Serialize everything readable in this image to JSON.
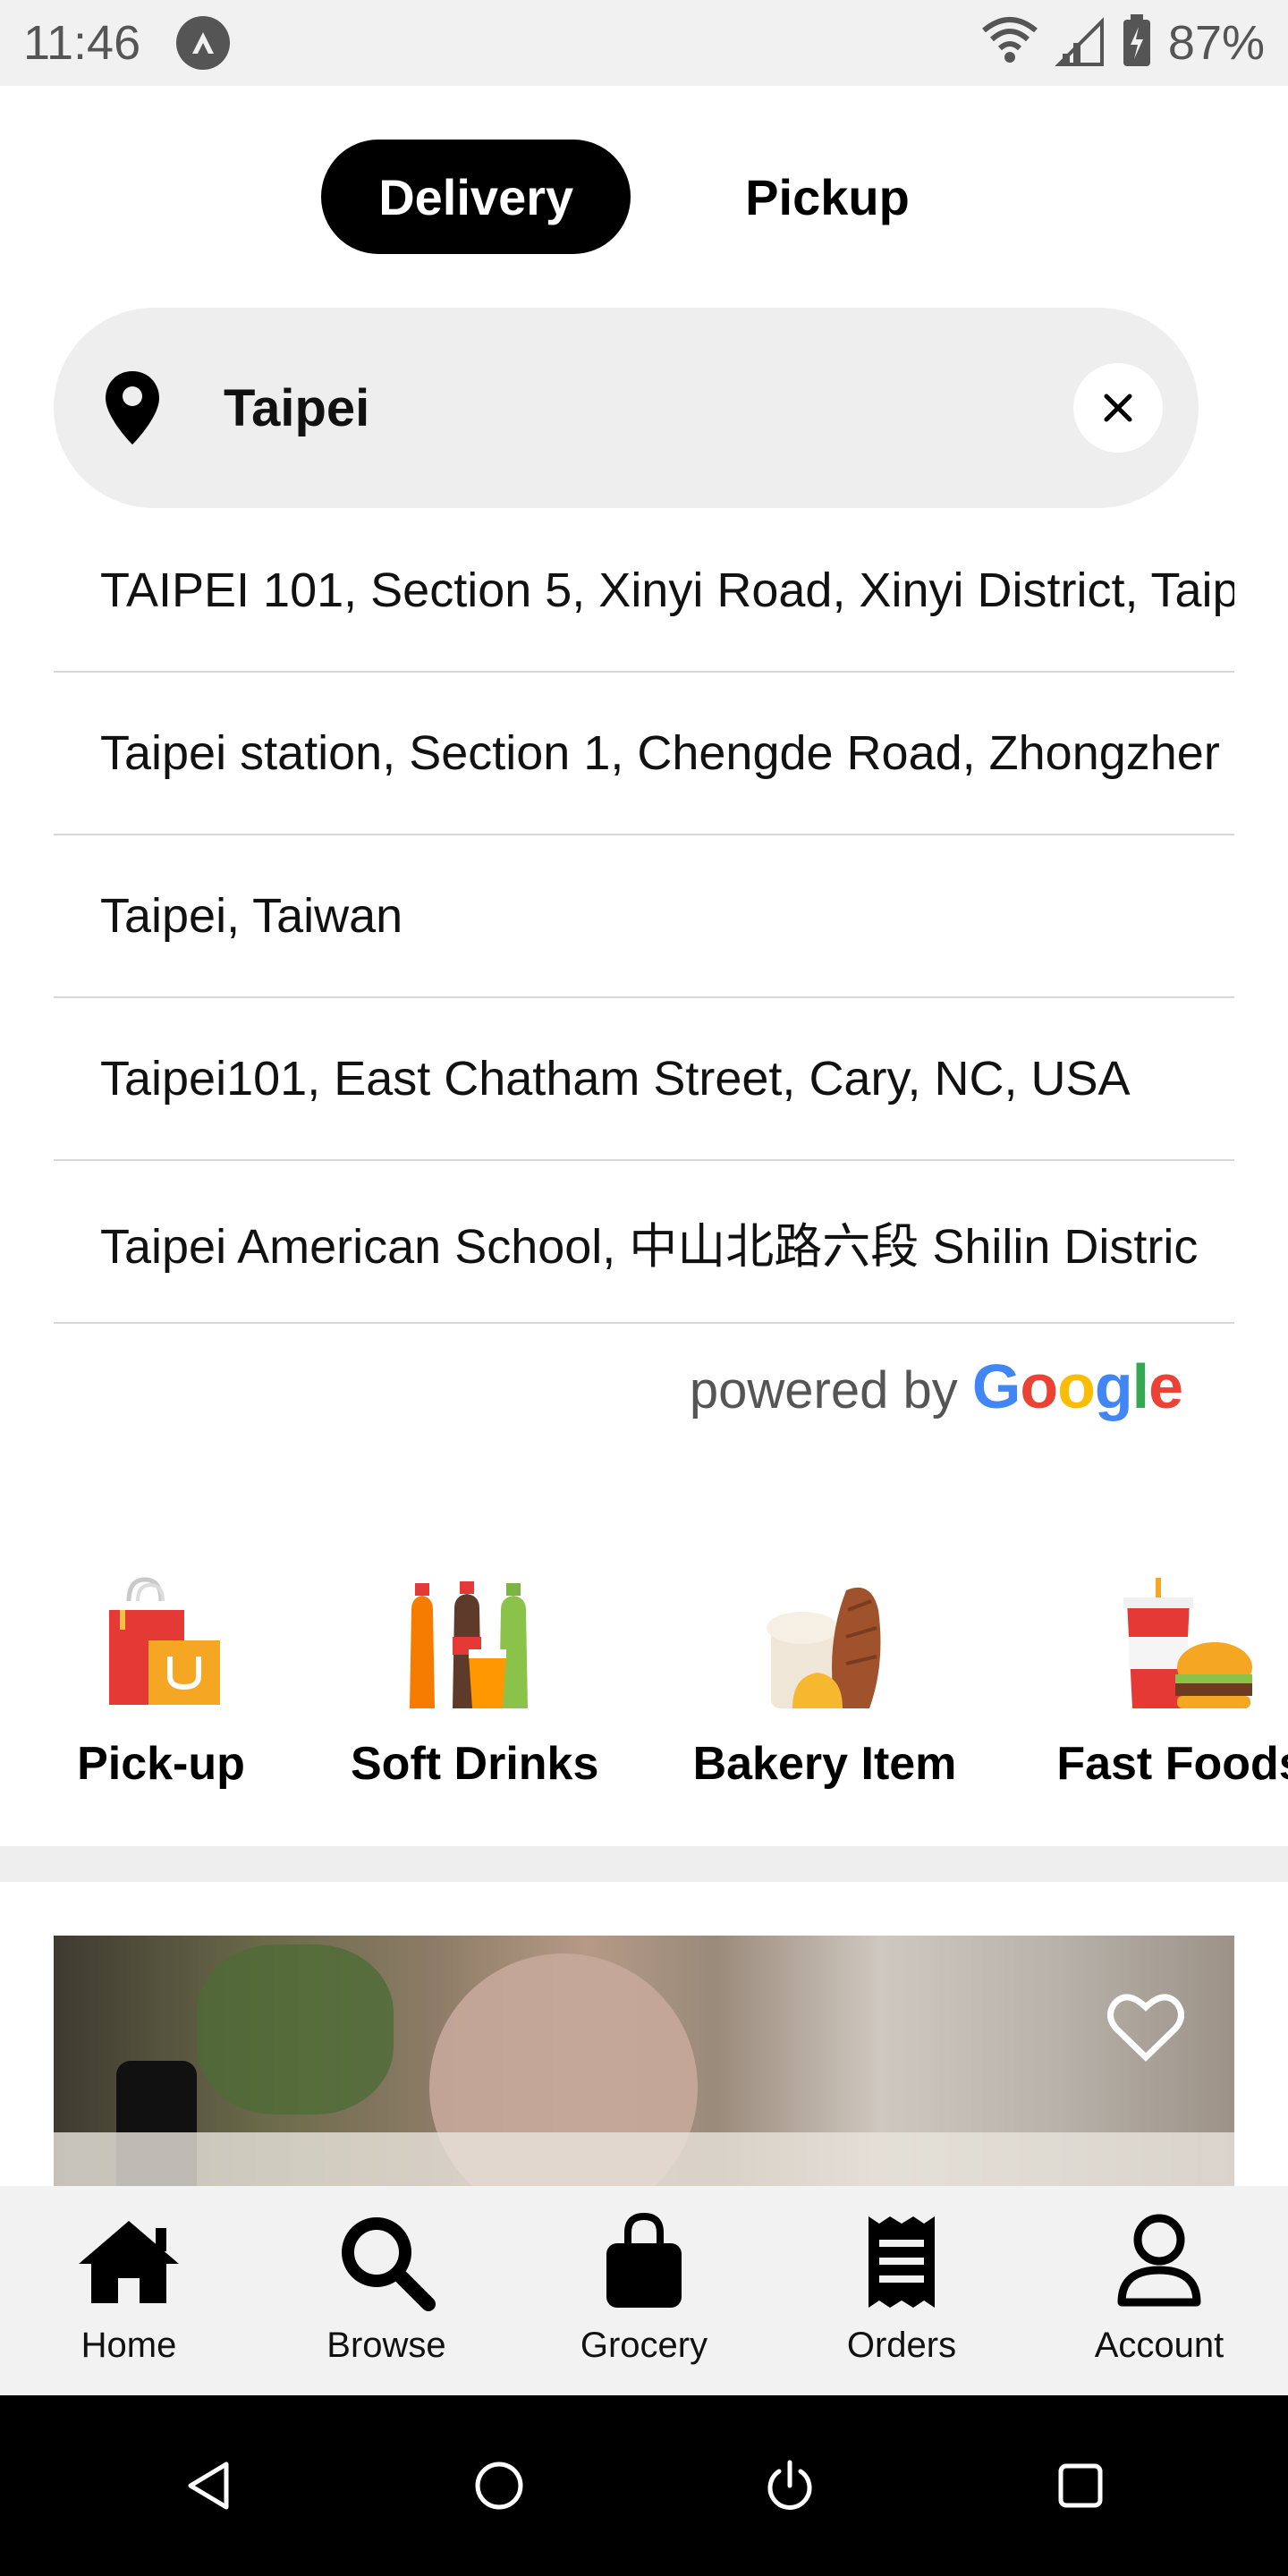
{
  "status_bar": {
    "time": "11:46",
    "battery": "87%"
  },
  "mode_toggle": {
    "delivery": "Delivery",
    "pickup": "Pickup"
  },
  "search": {
    "value": "Taipei"
  },
  "suggestions": [
    "TAIPEI 101, Section 5, Xinyi Road, Xinyi District, Taip",
    "Taipei station, Section 1, Chengde Road, Zhongzher",
    "Taipei, Taiwan",
    "Taipei101, East Chatham Street, Cary, NC, USA",
    "Taipei American School, 中山北路六段 Shilin Distric"
  ],
  "attribution": {
    "prefix": "powered by",
    "brand": [
      "G",
      "o",
      "o",
      "g",
      "l",
      "e"
    ]
  },
  "categories": [
    {
      "label": "Pick-up",
      "icon": "shopping-bags-icon"
    },
    {
      "label": "Soft Drinks",
      "icon": "soda-bottles-icon"
    },
    {
      "label": "Bakery Item",
      "icon": "bread-icon"
    },
    {
      "label": "Fast Foods",
      "icon": "burger-drink-icon"
    }
  ],
  "bottom_nav": [
    {
      "label": "Home",
      "icon": "home-icon"
    },
    {
      "label": "Browse",
      "icon": "search-icon"
    },
    {
      "label": "Grocery",
      "icon": "shopping-bag-icon"
    },
    {
      "label": "Orders",
      "icon": "receipt-icon"
    },
    {
      "label": "Account",
      "icon": "person-icon"
    }
  ],
  "colors": {
    "accent": "#000000",
    "search_bg": "#eeeeee",
    "nav_bg": "#f2f2f2"
  }
}
